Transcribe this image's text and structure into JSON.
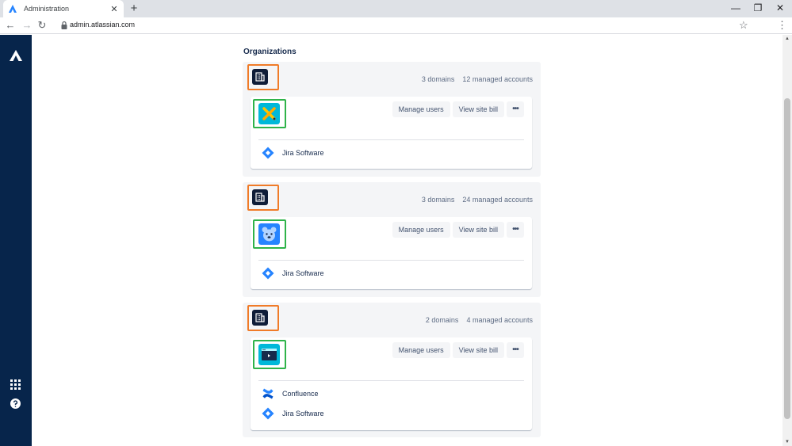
{
  "browser": {
    "tab_title": "Administration",
    "tab_close": "✕",
    "new_tab": "+",
    "url": "admin.atlassian.com",
    "back": "←",
    "forward": "→",
    "reload": "↻",
    "star": "☆",
    "menu": "⋮",
    "minimize": "—",
    "restore": "❐",
    "close": "✕"
  },
  "colors": {
    "sidebar": "#07254b",
    "org_highlight": "#f07b28",
    "site_highlight": "#2fb34a",
    "jira_blue": "#2684ff",
    "confluence_blue": "#0052cc"
  },
  "sidebar": {
    "logo_icon": "atlassian-logo-icon",
    "apps_icon": "app-switcher-icon",
    "help_icon": "help-icon"
  },
  "page": {
    "title": "Organizations"
  },
  "organizations": [
    {
      "domains": "3 domains",
      "accounts": "12 managed accounts",
      "site_avatar": "crossed-tools-avatar",
      "manage_users": "Manage users",
      "view_bill": "View site bill",
      "more": "•••",
      "products": [
        "Jira Software"
      ]
    },
    {
      "domains": "3 domains",
      "accounts": "24 managed accounts",
      "site_avatar": "bear-avatar",
      "manage_users": "Manage users",
      "view_bill": "View site bill",
      "more": "•••",
      "products": [
        "Jira Software"
      ]
    },
    {
      "domains": "2 domains",
      "accounts": "4 managed accounts",
      "site_avatar": "window-avatar",
      "manage_users": "Manage users",
      "view_bill": "View site bill",
      "more": "•••",
      "products": [
        "Confluence",
        "Jira Software"
      ]
    }
  ]
}
